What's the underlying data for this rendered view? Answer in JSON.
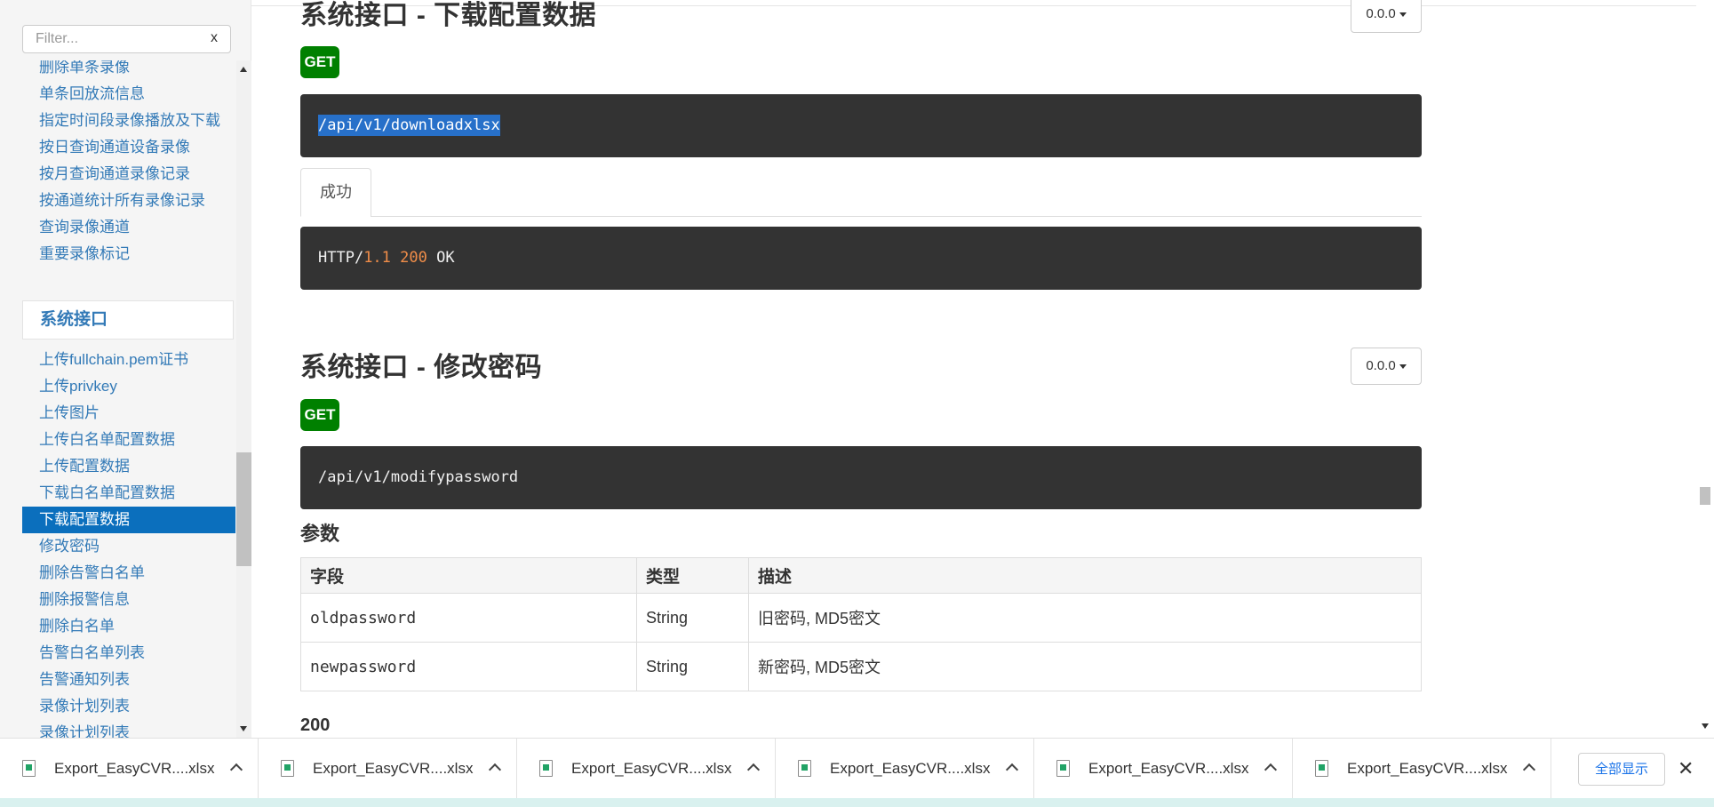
{
  "sidebar": {
    "filter_placeholder": "Filter...",
    "clear_label": "x",
    "group_prev": [
      "删除单条录像",
      "单条回放流信息",
      "指定时间段录像播放及下载",
      "按日查询通道设备录像",
      "按月查询通道录像记录",
      "按通道统计所有录像记录",
      "查询录像通道",
      "重要录像标记"
    ],
    "section_title": "系统接口",
    "group_system": [
      "上传fullchain.pem证书",
      "上传privkey",
      "上传图片",
      "上传白名单配置数据",
      "上传配置数据",
      "下载白名单配置数据",
      "下载配置数据",
      "修改密码",
      "删除告警白名单",
      "删除报警信息",
      "删除白名单",
      "告警白名单列表",
      "告警通知列表",
      "录像计划列表",
      "录像计划列表"
    ],
    "active_item": "下载配置数据"
  },
  "main": {
    "section1": {
      "title": "系统接口 - 下载配置数据",
      "version": "0.0.0",
      "method": "GET",
      "path": "/api/v1/downloadxlsx",
      "tab_label": "成功",
      "response": {
        "protocol": "HTTP/",
        "version": "1.1",
        "status": "200",
        "text": "OK"
      }
    },
    "section2": {
      "title": "系统接口 - 修改密码",
      "version": "0.0.0",
      "method": "GET",
      "path": "/api/v1/modifypassword",
      "params_title": "参数",
      "table": {
        "headers": [
          "字段",
          "类型",
          "描述"
        ],
        "rows": [
          {
            "field": "oldpassword",
            "type": "String",
            "desc": "旧密码, MD5密文"
          },
          {
            "field": "newpassword",
            "type": "String",
            "desc": "新密码, MD5密文"
          }
        ]
      },
      "response_code": "200"
    }
  },
  "download_bar": {
    "items": [
      "Export_EasyCVR....xlsx",
      "Export_EasyCVR....xlsx",
      "Export_EasyCVR....xlsx",
      "Export_EasyCVR....xlsx",
      "Export_EasyCVR....xlsx",
      "Export_EasyCVR....xlsx"
    ],
    "show_all": "全部显示",
    "close": "✕"
  }
}
